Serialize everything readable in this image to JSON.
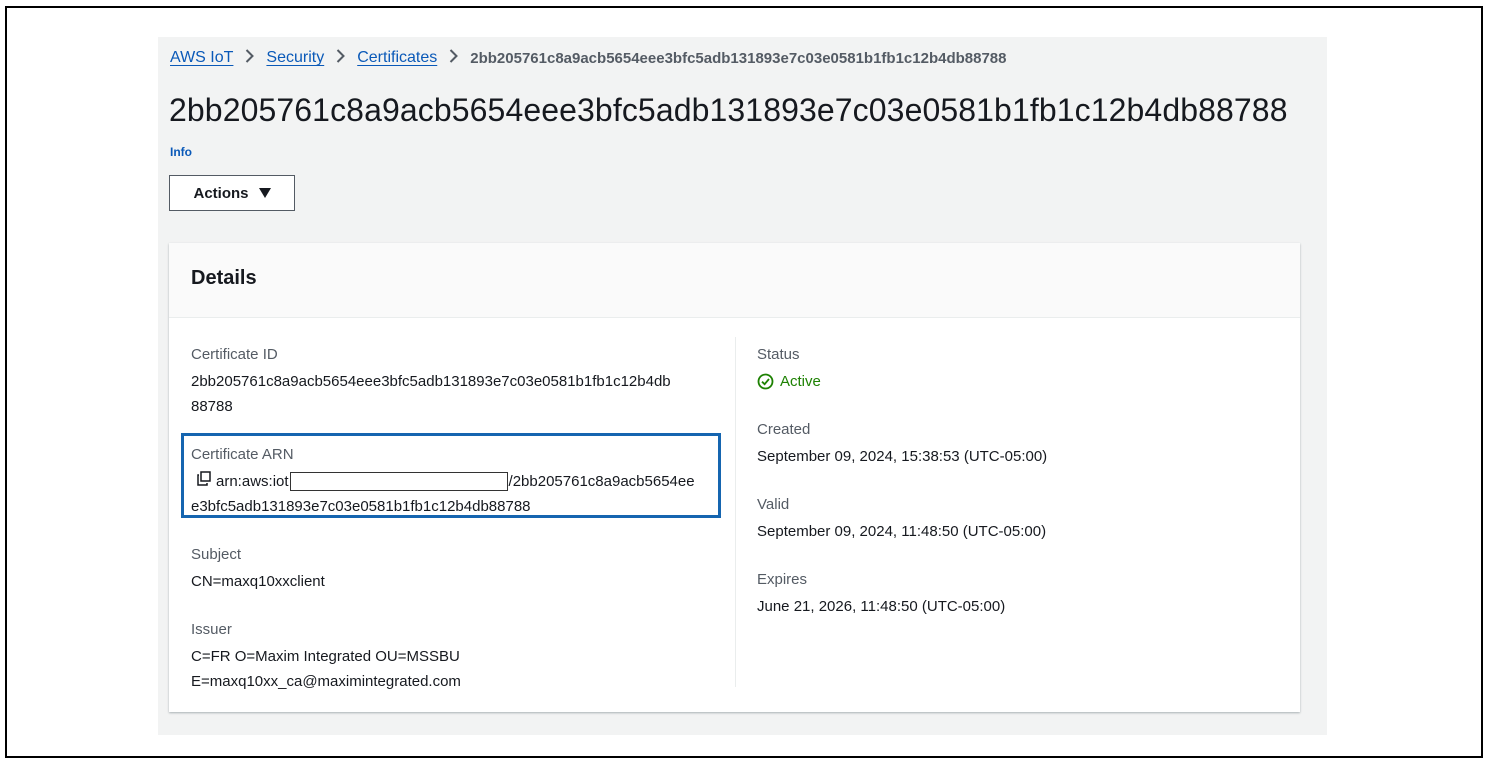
{
  "breadcrumb": {
    "items": [
      "AWS IoT",
      "Security",
      "Certificates"
    ],
    "current": "2bb205761c8a9acb5654eee3bfc5adb131893e7c03e0581b1fb1c12b4db88788"
  },
  "page": {
    "title": "2bb205761c8a9acb5654eee3bfc5adb131893e7c03e0581b1fb1c12b4db88788",
    "info_label": "Info",
    "actions_label": "Actions"
  },
  "details": {
    "heading": "Details",
    "certificate_id": {
      "label": "Certificate ID",
      "line1": "2bb205761c8a9acb5654eee3bfc5adb131893e7c03e0581b1fb1c12b4db",
      "line2": "88788"
    },
    "certificate_arn": {
      "label": "Certificate ARN",
      "prefix": "arn:aws:iot",
      "suffix": "/2bb205761c8a9acb5654ee",
      "line2": "e3bfc5adb131893e7c03e0581b1fb1c12b4db88788"
    },
    "subject": {
      "label": "Subject",
      "value": "CN=maxq10xxclient"
    },
    "issuer": {
      "label": "Issuer",
      "line1": "C=FR O=Maxim Integrated OU=MSSBU",
      "line2": "E=maxq10xx_ca@maximintegrated.com"
    },
    "status": {
      "label": "Status",
      "value": "Active"
    },
    "created": {
      "label": "Created",
      "value": "September 09, 2024, 15:38:53 (UTC-05:00)"
    },
    "valid": {
      "label": "Valid",
      "value": "September 09, 2024, 11:48:50 (UTC-05:00)"
    },
    "expires": {
      "label": "Expires",
      "value": "June 21, 2026, 11:48:50 (UTC-05:00)"
    }
  },
  "colors": {
    "link": "#0a59b8",
    "success": "#1d8102",
    "highlight": "#1565b0"
  }
}
